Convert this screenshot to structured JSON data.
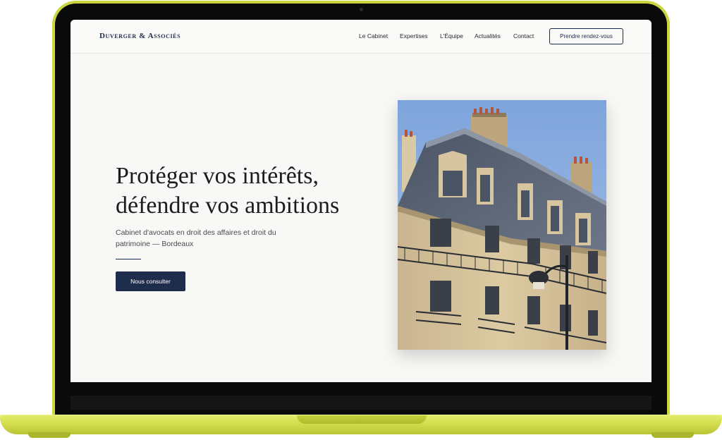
{
  "header": {
    "brand": "Duverger & Associés",
    "nav": [
      "Le Cabinet",
      "Expertises",
      "L'Équipe",
      "Actualités",
      "Contact"
    ],
    "cta": "Prendre rendez-vous"
  },
  "hero": {
    "title_line1": "Protéger vos intérêts,",
    "title_line2": "défendre vos ambitions",
    "subtitle_line1": "Cabinet d'avocats en droit des affaires et droit du",
    "subtitle_line2": "patrimoine — Bordeaux",
    "cta": "Nous consulter"
  },
  "colors": {
    "accent": "#1f2d4d",
    "device": "#c9d63e",
    "background": "#f8f8f6"
  },
  "image": {
    "subject": "haussmann-building-icon"
  }
}
